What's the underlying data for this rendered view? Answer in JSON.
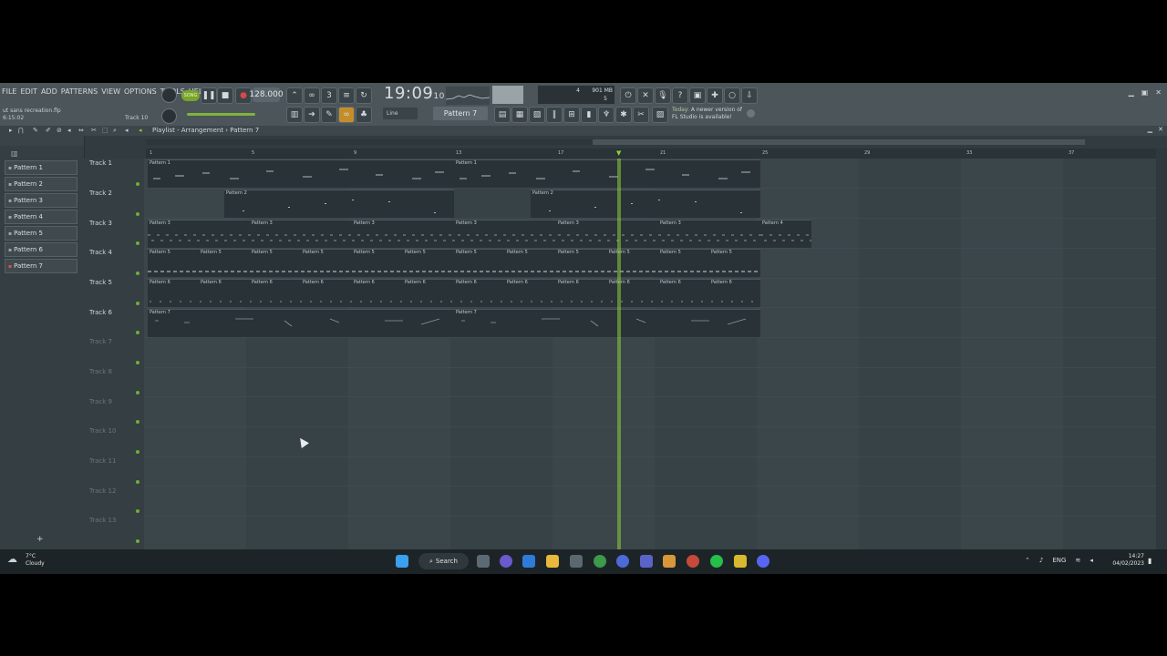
{
  "menu": [
    "FILE",
    "EDIT",
    "ADD",
    "PATTERNS",
    "VIEW",
    "OPTIONS",
    "TOOLS",
    "HELP"
  ],
  "file_name": "ut sans recreation.flp",
  "file_time": "6:15:02",
  "track_hint": "Track 10",
  "transport": {
    "song_label": "SONG",
    "tempo": "128.000"
  },
  "clock": {
    "main": "19:09",
    "sub": "10"
  },
  "memory": {
    "value1": "4",
    "value2": "901 MB",
    "value3": "5"
  },
  "snap": "Line",
  "pattern_selector": "Pattern 7",
  "news": {
    "prefix": "Today:",
    "line1": "A newer version of",
    "line2": "FL Studio is available!"
  },
  "playlist_title": "Playlist - Arrangement › Pattern 7",
  "patterns": [
    "Pattern 1",
    "Pattern 2",
    "Pattern 3",
    "Pattern 4",
    "Pattern 5",
    "Pattern 6",
    "Pattern 7"
  ],
  "tracks": [
    "Track 1",
    "Track 2",
    "Track 3",
    "Track 4",
    "Track 5",
    "Track 6",
    "Track 7",
    "Track 8",
    "Track 9",
    "Track 10",
    "Track 11",
    "Track 12",
    "Track 13"
  ],
  "ruler": [
    "1",
    "5",
    "9",
    "13",
    "17",
    "21",
    "25",
    "29",
    "33",
    "37"
  ],
  "clip_labels": {
    "p1": "Pattern 1",
    "p2": "Pattern 2",
    "p3": "Pattern 3",
    "p4": "Pattern 4",
    "p5": "Pattern 5",
    "p6": "Pattern 6",
    "p7": "Pattern 7"
  },
  "taskbar": {
    "temp": "7°C",
    "weather": "Cloudy",
    "search": "Search",
    "lang": "ENG",
    "time": "14:27",
    "date": "04/02/2023"
  }
}
